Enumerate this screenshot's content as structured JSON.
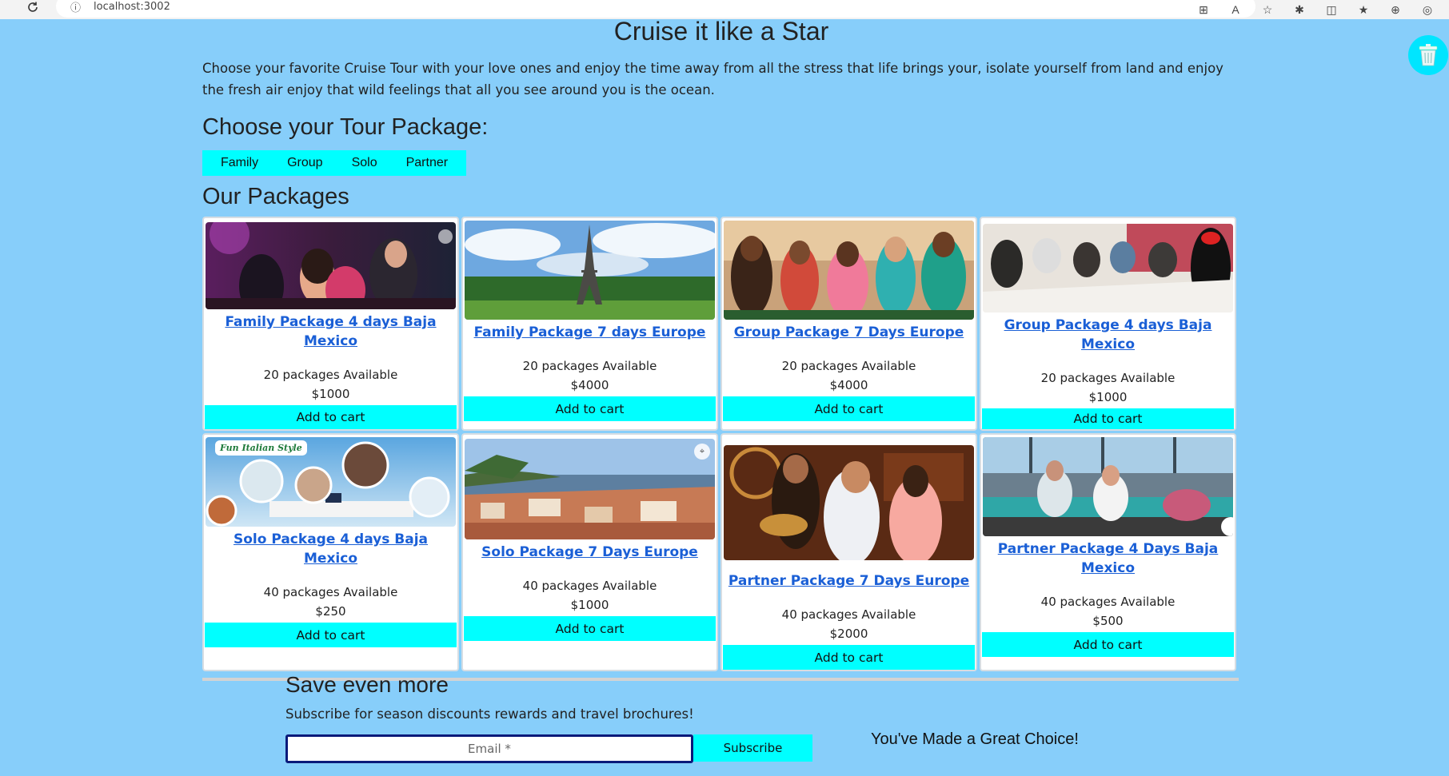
{
  "browser": {
    "address": "localhost:3002",
    "info_icon": "info-icon",
    "reload_icon": "reload-icon"
  },
  "site": {
    "title": "Cruise it like a Star",
    "intro": "Choose your favorite Cruise Tour with your love ones and enjoy the time away from all the stress that life brings your, isolate yourself from land and enjoy the fresh air enjoy that wild feelings that all you see around you is the ocean.",
    "choose_title": "Choose your Tour Package:",
    "filters": [
      "Family",
      "Group",
      "Solo",
      "Partner"
    ],
    "packages_title": "Our Packages"
  },
  "packages": [
    {
      "title": "Family Package 4 days Baja Mexico",
      "available": "20 packages Available",
      "price": "$1000",
      "button": "Add to cart"
    },
    {
      "title": "Family Package 7 days Europe",
      "available": "20 packages Available",
      "price": "$4000",
      "button": "Add to cart"
    },
    {
      "title": "Group Package 7 Days Europe",
      "available": "20 packages Available",
      "price": "$4000",
      "button": "Add to cart"
    },
    {
      "title": "Group Package 4 days Baja Mexico",
      "available": "20 packages Available",
      "price": "$1000",
      "button": "Add to cart"
    },
    {
      "title": "Solo Package 4 days Baja Mexico",
      "available": "40 packages Available",
      "price": "$250",
      "button": "Add to cart",
      "image_text": "Fun Italian Style"
    },
    {
      "title": "Solo Package 7 Days Europe",
      "available": "40 packages Available",
      "price": "$1000",
      "button": "Add to cart"
    },
    {
      "title": "Partner Package 7 Days Europe",
      "available": "40 packages Available",
      "price": "$2000",
      "button": "Add to cart"
    },
    {
      "title": "Partner Package 4 Days Baja Mexico",
      "available": "40 packages Available",
      "price": "$500",
      "button": "Add to cart"
    }
  ],
  "subscribe": {
    "title": "Save even more",
    "subtitle": "Subscribe for season discounts rewards and travel brochures!",
    "email_placeholder": "Email *",
    "button": "Subscribe"
  },
  "great_choice": "You've Made a Great Choice!",
  "colors": {
    "background": "#87cefa",
    "accent": "#00ffff",
    "link": "#1a5fd6"
  }
}
